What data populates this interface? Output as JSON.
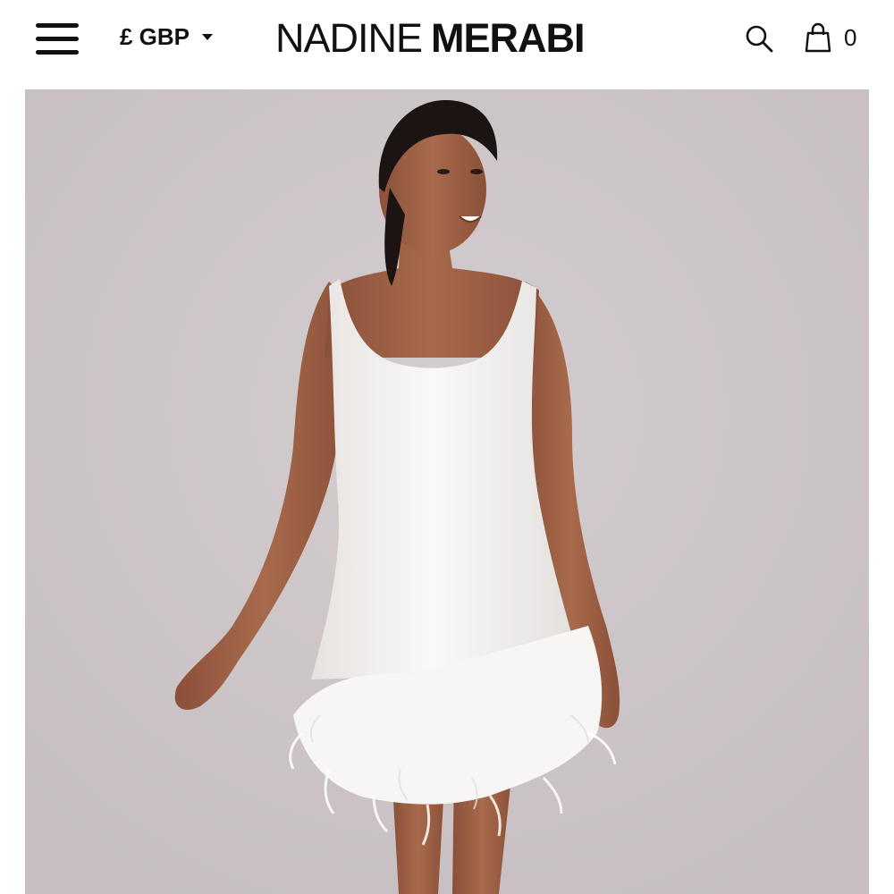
{
  "header": {
    "currency_label": "£ GBP",
    "logo_light": "NADINE",
    "logo_bold": "MERABI",
    "bag_count": "0"
  },
  "icons": {
    "menu": "hamburger-menu-icon",
    "currency_caret": "chevron-down-icon",
    "search": "search-icon",
    "bag": "shopping-bag-icon"
  },
  "colors": {
    "text": "#111111",
    "photo_background": "#ccc4c6",
    "dress": "#f5f3f1",
    "skin": "#9a5f45"
  }
}
